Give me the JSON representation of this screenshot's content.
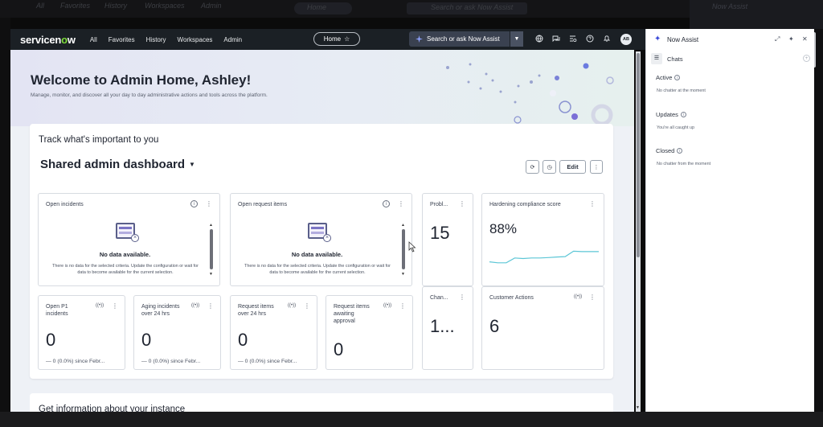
{
  "ghost": {
    "nav": [
      "All",
      "Favorites",
      "History",
      "Workspaces",
      "Admin"
    ],
    "home_pill": "Home",
    "search": "Search or ask Now Assist",
    "assist": "Now Assist"
  },
  "navbar": {
    "logo_pre": "servicen",
    "logo_o": "o",
    "logo_post": "w",
    "links": [
      "All",
      "Favorites",
      "History",
      "Workspaces",
      "Admin"
    ],
    "home_pill": "Home",
    "home_star": "☆",
    "search_label": "Search or ask Now Assist",
    "avatar": "AB"
  },
  "hero": {
    "title": "Welcome to Admin Home, Ashley!",
    "subtitle": "Manage, monitor, and discover all your day to day administrative actions and tools across the platform."
  },
  "card": {
    "track_title": "Track what's important to you",
    "dashboard_title": "Shared admin dashboard",
    "edit_label": "Edit"
  },
  "widgets": {
    "open_incidents": {
      "title": "Open incidents",
      "nodata_title": "No data available.",
      "nodata_text": "There is no data for the selected criteria. Update the configuration or wait for data to become available for the current selection."
    },
    "open_request_items": {
      "title": "Open request items",
      "nodata_title": "No data available.",
      "nodata_text": "There is no data for the selected criteria. Update the configuration or wait for data to become available for the current selection."
    },
    "problems": {
      "title": "Probl...",
      "value": "15"
    },
    "hardening": {
      "title": "Hardening compliance score",
      "value": "88%",
      "sparkline": [
        0.35,
        0.3,
        0.3,
        0.55,
        0.52,
        0.55,
        0.55,
        0.57,
        0.6,
        0.62,
        0.9,
        0.88,
        0.88,
        0.88
      ]
    },
    "open_p1": {
      "title_line1": "Open P1",
      "title_line2": "incidents",
      "value": "0",
      "since": "— 0 (0.0%) since Febr..."
    },
    "aging": {
      "title_line1": "Aging incidents",
      "title_line2": "over 24 hrs",
      "value": "0",
      "since": "— 0 (0.0%) since Febr..."
    },
    "request_items": {
      "title_line1": "Request items",
      "title_line2": "over 24 hrs",
      "value": "0",
      "since": "— 0 (0.0%) since Febr..."
    },
    "awaiting": {
      "title_line1": "Request items",
      "title_line2": "awaiting",
      "title_line3": "approval",
      "value": "0"
    },
    "changes": {
      "title": "Chan...",
      "value": "1..."
    },
    "customer_actions": {
      "title": "Customer Actions",
      "value": "6"
    }
  },
  "get_info": "Get information about your instance",
  "panel": {
    "title": "Now Assist",
    "chats_label": "Chats",
    "sections": [
      {
        "title": "Active",
        "note": "No chatter at the moment"
      },
      {
        "title": "Updates",
        "note": "You're all caught up"
      },
      {
        "title": "Closed",
        "note": "No chatter from the moment"
      }
    ]
  },
  "colors": {
    "navbar": "#1b2025",
    "accent_green": "#7ddc3a",
    "now_assist": "#3b4ad8",
    "sparkline": "#5cc6d6"
  }
}
